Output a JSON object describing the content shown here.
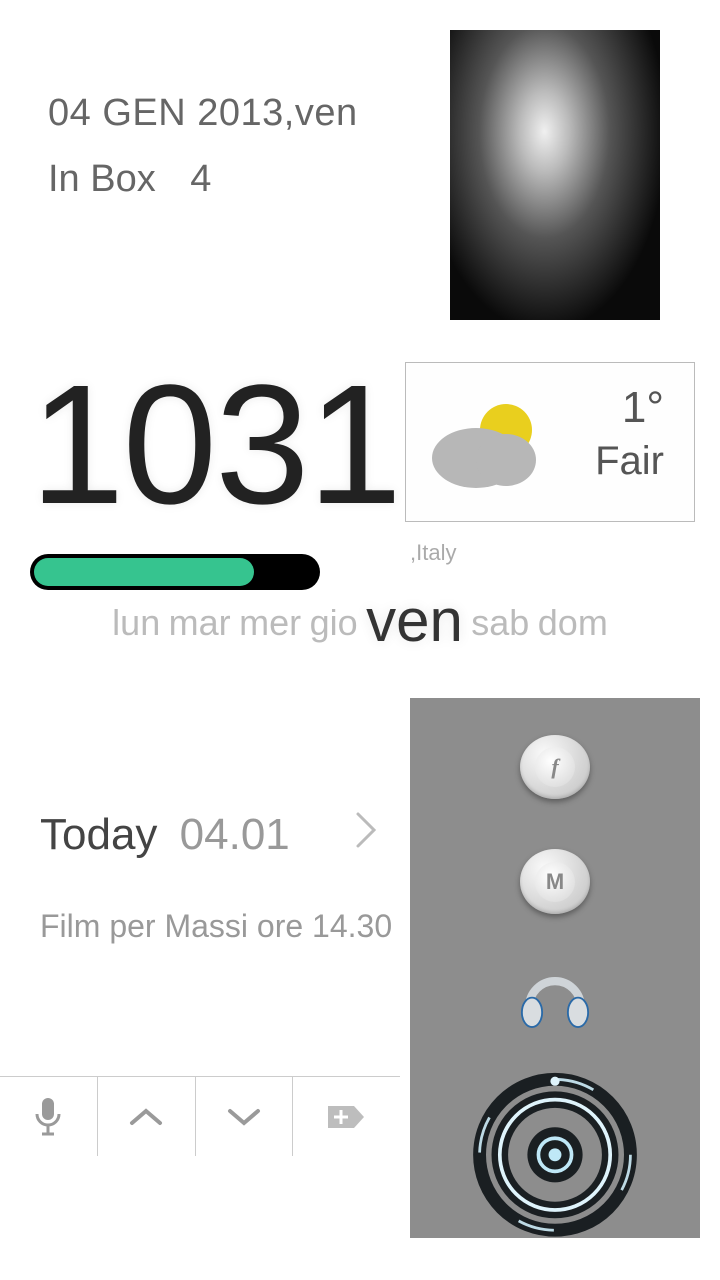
{
  "header": {
    "date": "04 GEN 2013,ven",
    "inbox_label": "In Box",
    "inbox_count": "4"
  },
  "clock": {
    "time": "1031",
    "battery_percent": 78
  },
  "weather": {
    "temp": "1°",
    "condition": "Fair",
    "location": ",Italy"
  },
  "week": {
    "days": [
      "lun",
      "mar",
      "mer",
      "gio",
      "ven",
      "sab",
      "dom"
    ],
    "current_index": 4
  },
  "agenda": {
    "today_label": "Today",
    "today_date": "04.01",
    "event": "Film per Massi ore 14.30"
  },
  "dock": {
    "items": [
      "flash",
      "gmail",
      "music",
      "camera"
    ]
  },
  "colors": {
    "battery_fill": "#36c48f",
    "panel": "#8d8d8d"
  }
}
